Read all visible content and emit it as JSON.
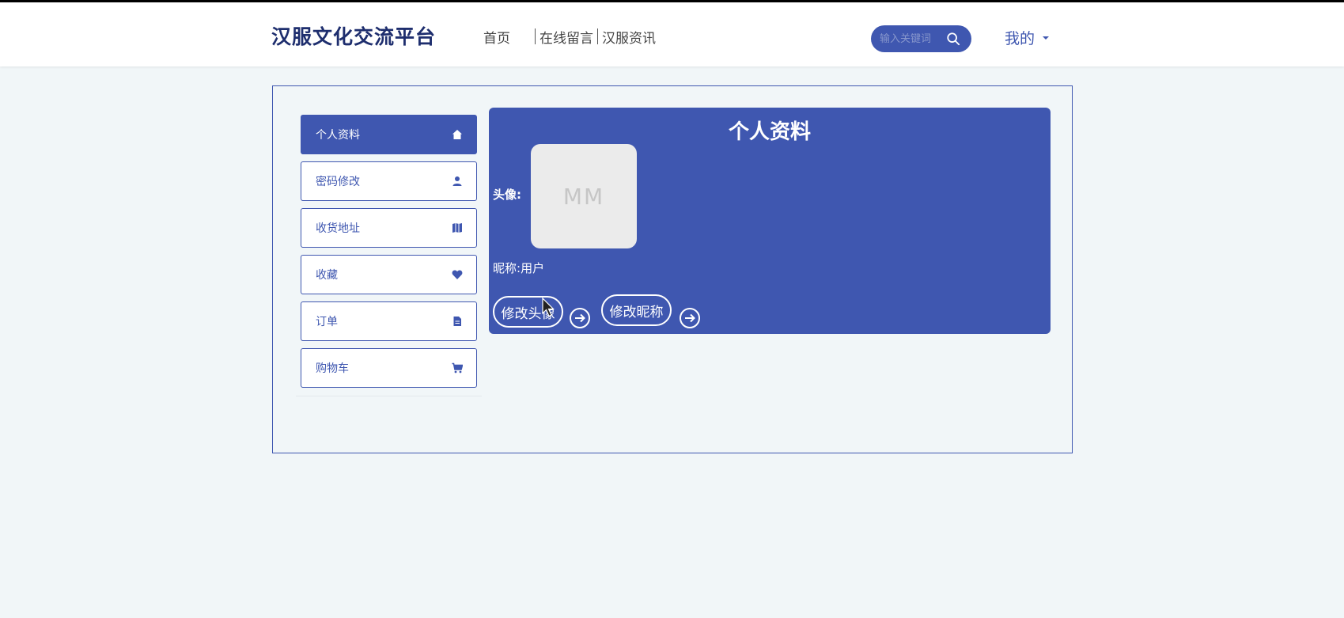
{
  "header": {
    "logo": "汉服文化交流平台",
    "nav": [
      "首页",
      "在线留言",
      "汉服资讯"
    ],
    "search_placeholder": "输入关键词",
    "user_menu": "我的"
  },
  "sidebar": {
    "items": [
      {
        "label": "个人资料",
        "icon": "home-icon",
        "active": true
      },
      {
        "label": "密码修改",
        "icon": "user-icon",
        "active": false
      },
      {
        "label": "收货地址",
        "icon": "map-icon",
        "active": false
      },
      {
        "label": "收藏",
        "icon": "heart-icon",
        "active": false
      },
      {
        "label": "订单",
        "icon": "file-icon",
        "active": false
      },
      {
        "label": "购物车",
        "icon": "cart-icon",
        "active": false
      }
    ]
  },
  "profile": {
    "title": "个人资料",
    "avatar_label": "头像:",
    "avatar_text": "MM",
    "nickname_label": "昵称:",
    "nickname_value": "用户",
    "change_avatar_button": "修改头像",
    "change_nickname_button": "修改昵称"
  },
  "colors": {
    "primary": "#3f57b0",
    "logo": "#1e2e6e",
    "background": "#f1f6f8"
  }
}
